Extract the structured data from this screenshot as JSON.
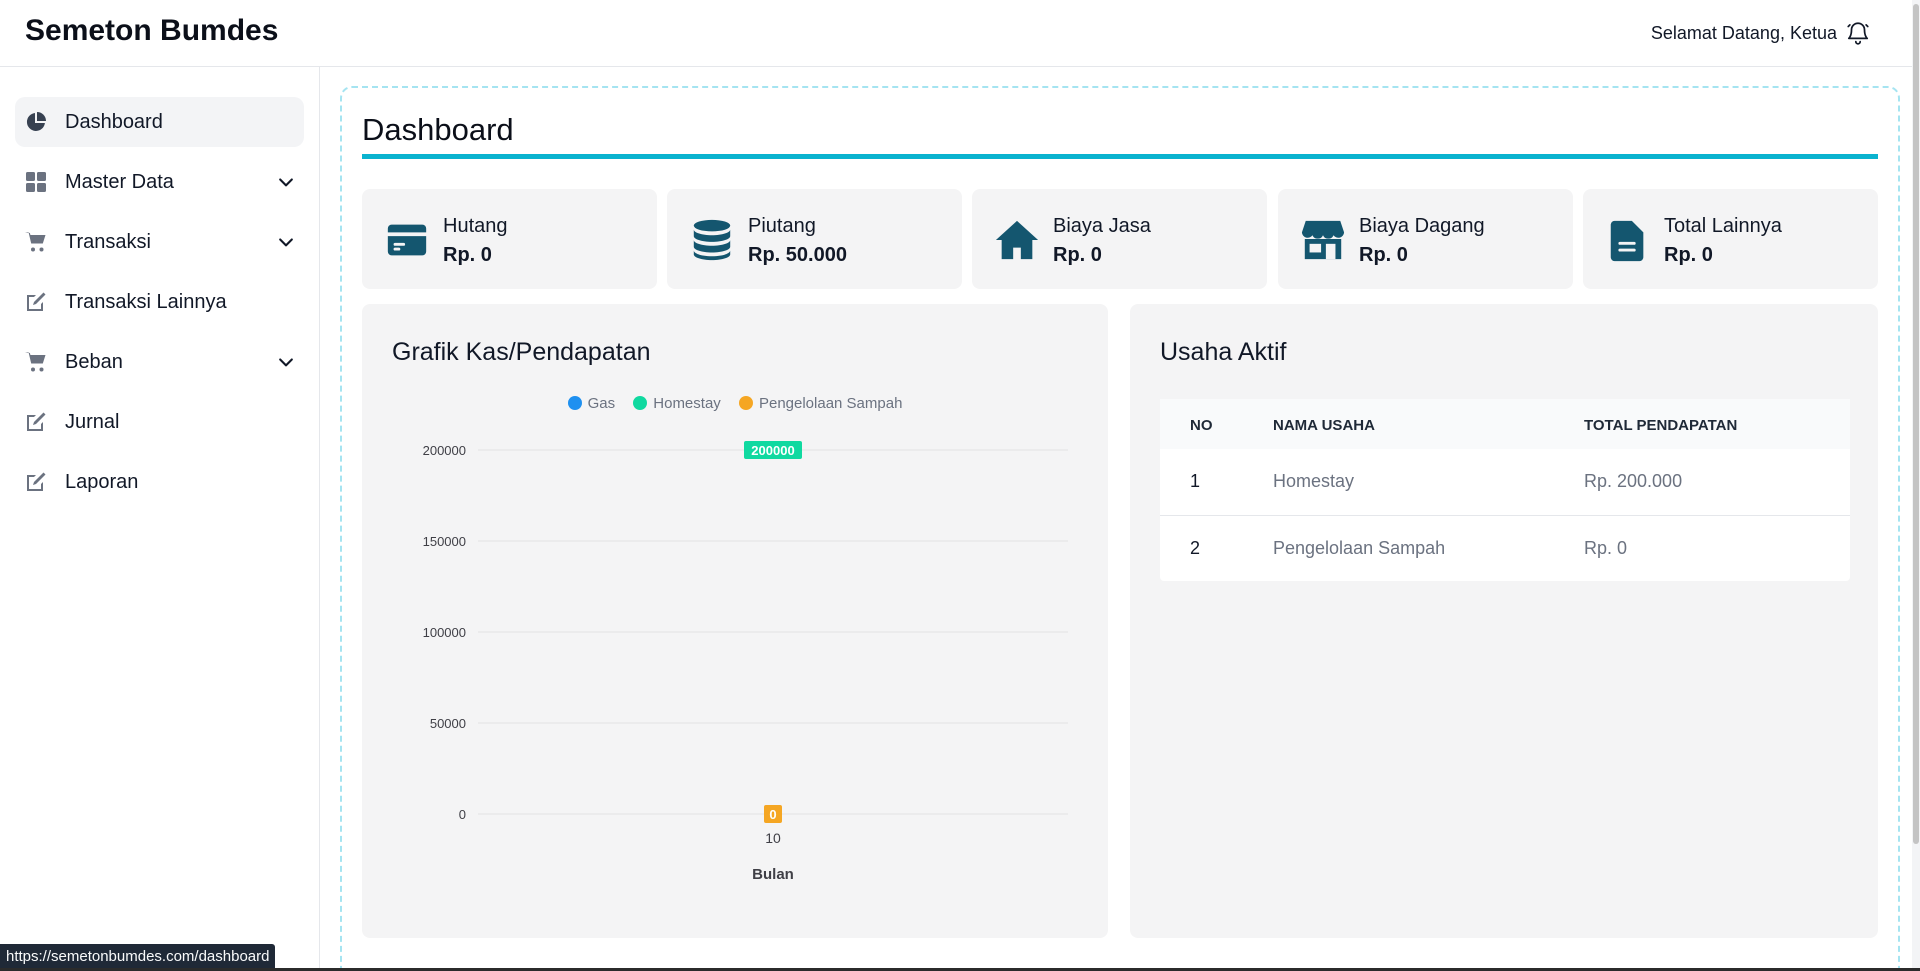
{
  "header": {
    "brand": "Semeton Bumdes",
    "welcome": "Selamat Datang, Ketua"
  },
  "sidebar": {
    "items": [
      {
        "label": "Dashboard",
        "icon": "pie-chart-icon",
        "active": true
      },
      {
        "label": "Master Data",
        "icon": "grid-icon",
        "expandable": true
      },
      {
        "label": "Transaksi",
        "icon": "cart-icon",
        "expandable": true
      },
      {
        "label": "Transaksi Lainnya",
        "icon": "edit-icon"
      },
      {
        "label": "Beban",
        "icon": "cart-icon",
        "expandable": true
      },
      {
        "label": "Jurnal",
        "icon": "edit-icon"
      },
      {
        "label": "Laporan",
        "icon": "edit-icon"
      }
    ]
  },
  "main": {
    "title": "Dashboard",
    "stats": [
      {
        "label": "Hutang",
        "value": "Rp. 0",
        "icon": "credit-card-icon"
      },
      {
        "label": "Piutang",
        "value": "Rp. 50.000",
        "icon": "database-icon"
      },
      {
        "label": "Biaya Jasa",
        "value": "Rp. 0",
        "icon": "home-icon"
      },
      {
        "label": "Biaya Dagang",
        "value": "Rp. 0",
        "icon": "store-icon"
      },
      {
        "label": "Total Lainnya",
        "value": "Rp. 0",
        "icon": "document-icon"
      }
    ],
    "chart_panel": {
      "title": "Grafik Kas/Pendapatan"
    },
    "usaha_panel": {
      "title": "Usaha Aktif",
      "columns": [
        "NO",
        "NAMA USAHA",
        "TOTAL PENDAPATAN"
      ],
      "rows": [
        [
          "1",
          "Homestay",
          "Rp. 200.000"
        ],
        [
          "2",
          "Pengelolaan Sampah",
          "Rp. 0"
        ]
      ]
    }
  },
  "chart_data": {
    "type": "bar",
    "categories": [
      "10"
    ],
    "series": [
      {
        "name": "Gas",
        "values": [
          null
        ],
        "color": "#1e90f0"
      },
      {
        "name": "Homestay",
        "values": [
          200000
        ],
        "color": "#10d9a0"
      },
      {
        "name": "Pengelolaan Sampah",
        "values": [
          0
        ],
        "color": "#f5a623"
      }
    ],
    "data_labels": [
      "200000",
      "0"
    ],
    "xlabel": "Bulan",
    "ylabel": "",
    "ylim": [
      0,
      200000
    ],
    "yticks": [
      "200000",
      "150000",
      "100000",
      "50000",
      "0"
    ],
    "grid": true,
    "legend": "top"
  },
  "colors": {
    "accent": "#0ab3cf",
    "icon": "#14566f"
  },
  "statusbar": {
    "url": "https://semetonbumdes.com/dashboard"
  }
}
